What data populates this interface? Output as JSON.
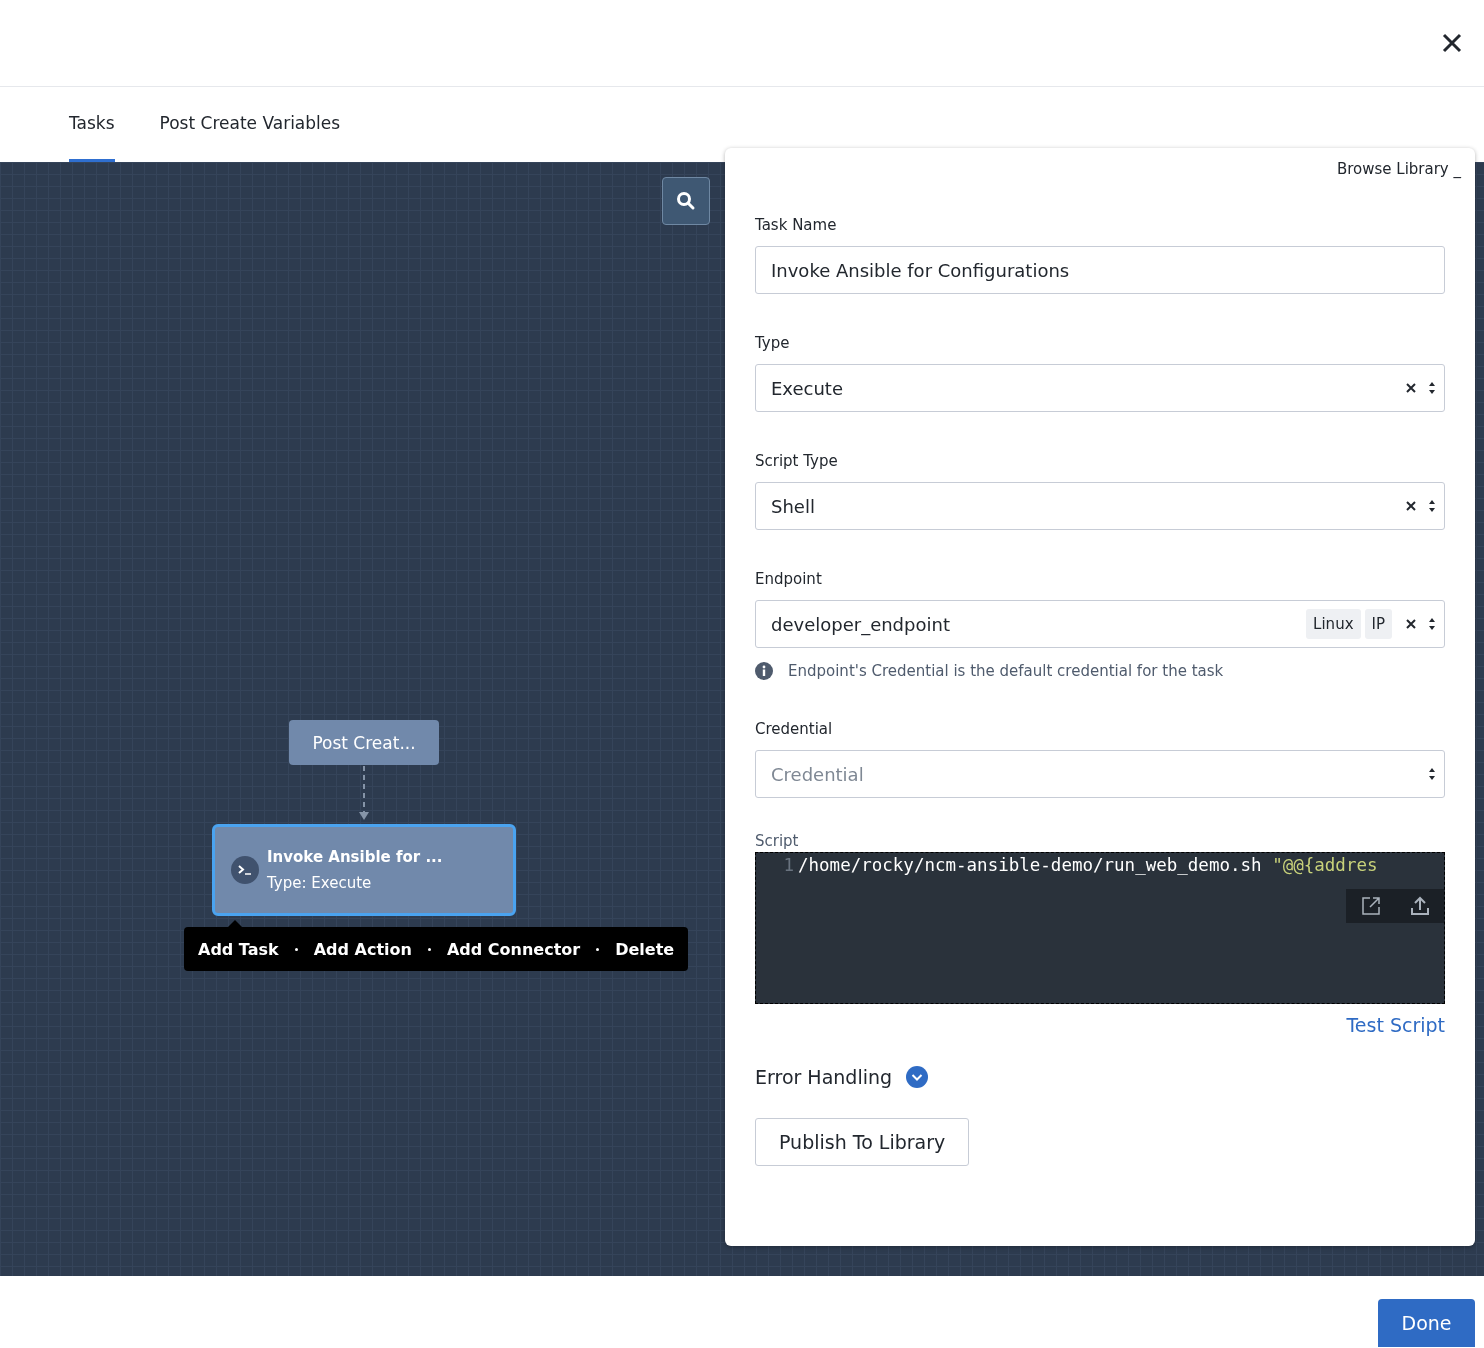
{
  "tabs": [
    {
      "label": "Tasks",
      "selected": true
    },
    {
      "label": "Post Create Variables",
      "selected": false
    }
  ],
  "canvas": {
    "nodes": [
      {
        "kind": "stage",
        "title": "Post Creat..."
      },
      {
        "kind": "task",
        "title": "Invoke Ansible for ...",
        "subtitle": "Type: Execute",
        "selected": true
      }
    ],
    "context_menu": [
      "Add Task",
      "Add Action",
      "Add Connector",
      "Delete"
    ]
  },
  "panel": {
    "browse_library": "Browse Library _",
    "fields": [
      {
        "kind": "text",
        "label": "Task Name",
        "value": "Invoke Ansible for Configurations"
      },
      {
        "kind": "select",
        "label": "Type",
        "value": "Execute",
        "clearable": true
      },
      {
        "kind": "select",
        "label": "Script Type",
        "value": "Shell",
        "clearable": true
      },
      {
        "kind": "select",
        "label": "Endpoint",
        "value": "developer_endpoint",
        "tags": [
          "Linux",
          "IP"
        ],
        "clearable": true,
        "hint": "Endpoint's Credential is the default credential for the task"
      },
      {
        "kind": "select",
        "label": "Credential",
        "placeholder": "Credential",
        "clearable": false
      }
    ],
    "script": {
      "label": "Script",
      "line_number": "1",
      "code": "/home/rocky/ncm-ansible-demo/run_web_demo.sh",
      "string": "\"@@{addres"
    },
    "test_script": "Test Script",
    "error_handling": "Error Handling",
    "publish_button": "Publish To Library"
  },
  "done_button": "Done"
}
